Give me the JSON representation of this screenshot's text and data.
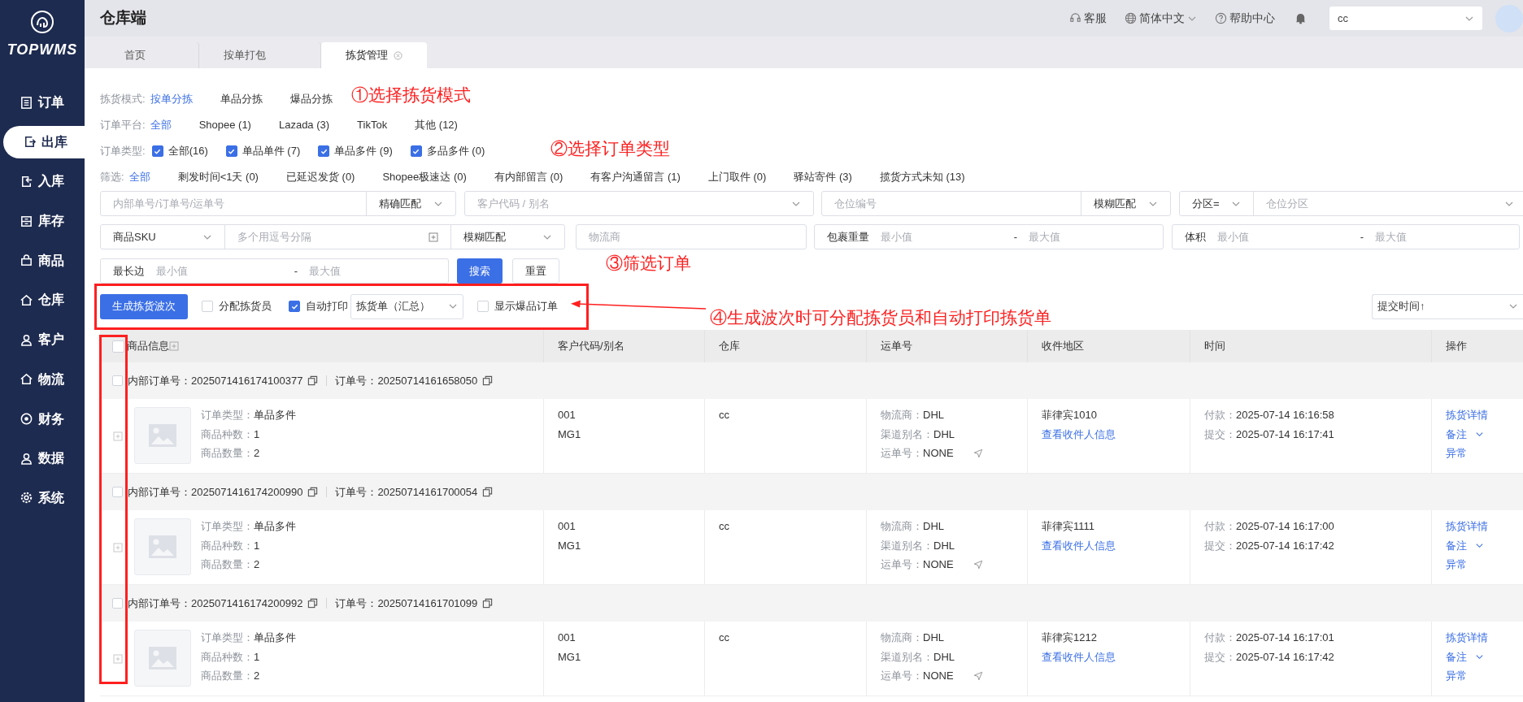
{
  "app": {
    "logo_text": "TOPWMS"
  },
  "sidebar": {
    "items": [
      {
        "label": "订单",
        "selected": false
      },
      {
        "label": "出库",
        "selected": true
      },
      {
        "label": "入库",
        "selected": false
      },
      {
        "label": "库存",
        "selected": false
      },
      {
        "label": "商品",
        "selected": false
      },
      {
        "label": "仓库",
        "selected": false
      },
      {
        "label": "客户",
        "selected": false
      },
      {
        "label": "物流",
        "selected": false
      },
      {
        "label": "财务",
        "selected": false
      },
      {
        "label": "数据",
        "selected": false
      },
      {
        "label": "系统",
        "selected": false
      }
    ]
  },
  "header": {
    "title": "仓库端",
    "service": "客服",
    "language": "简体中文",
    "help": "帮助中心",
    "user_select": "cc"
  },
  "tabs": [
    {
      "label": "首页",
      "selected": false,
      "closable": false
    },
    {
      "label": "按单打包",
      "selected": false,
      "closable": false
    },
    {
      "label": "拣货管理",
      "selected": true,
      "closable": true
    }
  ],
  "filter_lines": [
    {
      "label": "拣货模式:",
      "kind": "options",
      "options": [
        {
          "label": "按单分拣",
          "selected": true
        },
        {
          "label": "单品分拣",
          "selected": false
        },
        {
          "label": "爆品分拣",
          "selected": false
        }
      ]
    },
    {
      "label": "订单平台:",
      "kind": "options",
      "options": [
        {
          "label": "全部",
          "selected": true
        },
        {
          "label": "Shopee (1)",
          "selected": false
        },
        {
          "label": "Lazada (3)",
          "selected": false
        },
        {
          "label": "TikTok",
          "selected": false
        },
        {
          "label": "其他 (12)",
          "selected": false
        }
      ]
    },
    {
      "label": "订单类型:",
      "kind": "checks",
      "options": [
        {
          "label": "全部(16)",
          "checked": true
        },
        {
          "label": "单品单件 (7)",
          "checked": true
        },
        {
          "label": "单品多件 (9)",
          "checked": true
        },
        {
          "label": "多品多件 (0)",
          "checked": true
        }
      ]
    },
    {
      "label": "筛选:",
      "kind": "options",
      "options": [
        {
          "label": "全部",
          "selected": true
        },
        {
          "label": "剩发时间<1天 (0)",
          "selected": false
        },
        {
          "label": "已延迟发货 (0)",
          "selected": false
        },
        {
          "label": "Shopee极速达 (0)",
          "selected": false
        },
        {
          "label": "有内部留言 (0)",
          "selected": false
        },
        {
          "label": "有客户沟通留言 (1)",
          "selected": false
        },
        {
          "label": "上门取件 (0)",
          "selected": false
        },
        {
          "label": "驿站寄件 (3)",
          "selected": false
        },
        {
          "label": "揽货方式未知 (13)",
          "selected": false
        }
      ]
    }
  ],
  "search_rows": [
    {
      "groups": [
        {
          "parts": [
            {
              "kind": "input",
              "placeholder": "内部单号/订单号/运单号"
            },
            {
              "kind": "select",
              "value": "精确匹配"
            }
          ]
        },
        {
          "parts": [
            {
              "kind": "select",
              "placeholder": "客户代码 / 别名"
            }
          ]
        },
        {
          "parts": [
            {
              "kind": "input",
              "placeholder": "仓位编号"
            },
            {
              "kind": "select",
              "value": "模糊匹配"
            }
          ]
        },
        {
          "parts": [
            {
              "kind": "select",
              "value": "分区="
            },
            {
              "kind": "select",
              "placeholder": "仓位分区"
            }
          ]
        }
      ]
    },
    {
      "groups": [
        {
          "parts": [
            {
              "kind": "select",
              "value": "商品SKU"
            },
            {
              "kind": "input_plus",
              "placeholder": "多个用逗号分隔"
            },
            {
              "kind": "select",
              "value": "模糊匹配"
            }
          ]
        },
        {
          "parts": [
            {
              "kind": "input",
              "placeholder": "物流商"
            }
          ]
        },
        {
          "parts": [
            {
              "kind": "range",
              "label": "包裹重量",
              "min_placeholder": "最小值",
              "separator": "-",
              "max_placeholder": "最大值"
            }
          ]
        },
        {
          "parts": [
            {
              "kind": "range",
              "label": "体积",
              "min_placeholder": "最小值",
              "separator": "-",
              "max_placeholder": "最大值"
            }
          ]
        }
      ]
    },
    {
      "groups": [
        {
          "parts": [
            {
              "kind": "range",
              "label": "最长边",
              "min_placeholder": "最小值",
              "separator": "-",
              "max_placeholder": "最大值"
            }
          ]
        }
      ]
    }
  ],
  "search_buttons": [
    {
      "label": "搜索",
      "primary": true
    },
    {
      "label": "重置",
      "primary": false
    }
  ],
  "actions": {
    "generate_button": "生成拣货波次",
    "assign_picker": {
      "label": "分配拣货员",
      "checked": false
    },
    "auto_print": {
      "label": "自动打印",
      "checked": true
    },
    "print_select": "拣货单（汇总）",
    "show_hot": {
      "label": "显示爆品订单",
      "checked": false
    },
    "sort_select": "提交时间↑"
  },
  "table": {
    "select_all_checked": false,
    "columns": [
      "商品信息",
      "客户代码/别名",
      "仓库",
      "运单号",
      "收件地区",
      "时间",
      "操作"
    ],
    "orders": [
      {
        "checked": false,
        "internal_no_label": "内部订单号：",
        "internal_no": "2025071416174100377",
        "order_no_label": "订单号：",
        "order_no": "20250714161658050",
        "product_info": [
          {
            "label": "订单类型：",
            "value": "单品多件"
          },
          {
            "label": "商品种数：",
            "value": "1"
          },
          {
            "label": "商品数量：",
            "value": "2"
          }
        ],
        "customer": [
          "001",
          "MG1"
        ],
        "warehouse": "cc",
        "shipping": [
          {
            "label": "物流商：",
            "value": "DHL"
          },
          {
            "label": "渠道别名：",
            "value": "DHL"
          },
          {
            "label": "运单号：",
            "value": "NONE"
          }
        ],
        "region": "菲律宾1010",
        "region_link": "查看收件人信息",
        "times": [
          {
            "label": "付款：",
            "value": "2025-07-14 16:16:58"
          },
          {
            "label": "提交：",
            "value": "2025-07-14 16:17:41"
          }
        ],
        "ops": [
          {
            "label": "拣货详情",
            "dropdown": false
          },
          {
            "label": "备注",
            "dropdown": true
          },
          {
            "label": "异常",
            "dropdown": false
          }
        ]
      },
      {
        "checked": false,
        "internal_no_label": "内部订单号：",
        "internal_no": "2025071416174200990",
        "order_no_label": "订单号：",
        "order_no": "20250714161700054",
        "product_info": [
          {
            "label": "订单类型：",
            "value": "单品多件"
          },
          {
            "label": "商品种数：",
            "value": "1"
          },
          {
            "label": "商品数量：",
            "value": "2"
          }
        ],
        "customer": [
          "001",
          "MG1"
        ],
        "warehouse": "cc",
        "shipping": [
          {
            "label": "物流商：",
            "value": "DHL"
          },
          {
            "label": "渠道别名：",
            "value": "DHL"
          },
          {
            "label": "运单号：",
            "value": "NONE"
          }
        ],
        "region": "菲律宾1111",
        "region_link": "查看收件人信息",
        "times": [
          {
            "label": "付款：",
            "value": "2025-07-14 16:17:00"
          },
          {
            "label": "提交：",
            "value": "2025-07-14 16:17:42"
          }
        ],
        "ops": [
          {
            "label": "拣货详情",
            "dropdown": false
          },
          {
            "label": "备注",
            "dropdown": true
          },
          {
            "label": "异常",
            "dropdown": false
          }
        ]
      },
      {
        "checked": false,
        "internal_no_label": "内部订单号：",
        "internal_no": "2025071416174200992",
        "order_no_label": "订单号：",
        "order_no": "20250714161701099",
        "product_info": [
          {
            "label": "订单类型：",
            "value": "单品多件"
          },
          {
            "label": "商品种数：",
            "value": "1"
          },
          {
            "label": "商品数量：",
            "value": "2"
          }
        ],
        "customer": [
          "001",
          "MG1"
        ],
        "warehouse": "cc",
        "shipping": [
          {
            "label": "物流商：",
            "value": "DHL"
          },
          {
            "label": "渠道别名：",
            "value": "DHL"
          },
          {
            "label": "运单号：",
            "value": "NONE"
          }
        ],
        "region": "菲律宾1212",
        "region_link": "查看收件人信息",
        "times": [
          {
            "label": "付款：",
            "value": "2025-07-14 16:17:01"
          },
          {
            "label": "提交：",
            "value": "2025-07-14 16:17:42"
          }
        ],
        "ops": [
          {
            "label": "拣货详情",
            "dropdown": false
          },
          {
            "label": "备注",
            "dropdown": true
          },
          {
            "label": "异常",
            "dropdown": false
          }
        ]
      }
    ]
  },
  "annotations": [
    {
      "text": "①选择拣货模式"
    },
    {
      "text": "②选择订单类型"
    },
    {
      "text": "③筛选订单"
    },
    {
      "text": "④生成波次时可分配拣货员和自动打印拣货单"
    }
  ]
}
